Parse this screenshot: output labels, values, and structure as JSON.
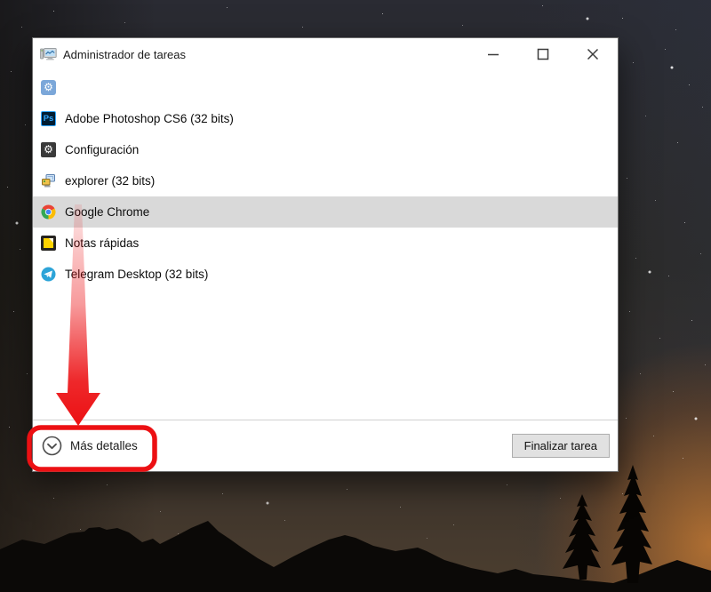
{
  "desktop": {
    "wallpaper": "night-sky-with-mountains-and-conifers",
    "glow_color": "#ec8c30"
  },
  "window": {
    "title": "Administrador de tareas",
    "app_icon": "task-manager-icon",
    "controls": {
      "minimize": "minimize",
      "maximize": "maximize",
      "close": "close"
    },
    "tasks": [
      {
        "label": "",
        "icon": "settings-blue-icon"
      },
      {
        "label": "Adobe Photoshop CS6 (32 bits)",
        "icon": "photoshop-icon",
        "badge": "Ps"
      },
      {
        "label": "Configuración",
        "icon": "settings-gear-icon",
        "gear_glyph": "⚙"
      },
      {
        "label": "explorer (32 bits)",
        "icon": "explorer-icon"
      },
      {
        "label": "Google Chrome",
        "icon": "chrome-icon",
        "selected": true
      },
      {
        "label": "Notas rápidas",
        "icon": "sticky-notes-icon"
      },
      {
        "label": "Telegram Desktop (32 bits)",
        "icon": "telegram-icon"
      }
    ],
    "footer": {
      "more_details": "Más detalles",
      "end_task": "Finalizar tarea"
    }
  },
  "annotation": {
    "color": "#ec1013",
    "type": "arrow-and-highlight-box",
    "target": "Más detalles"
  }
}
